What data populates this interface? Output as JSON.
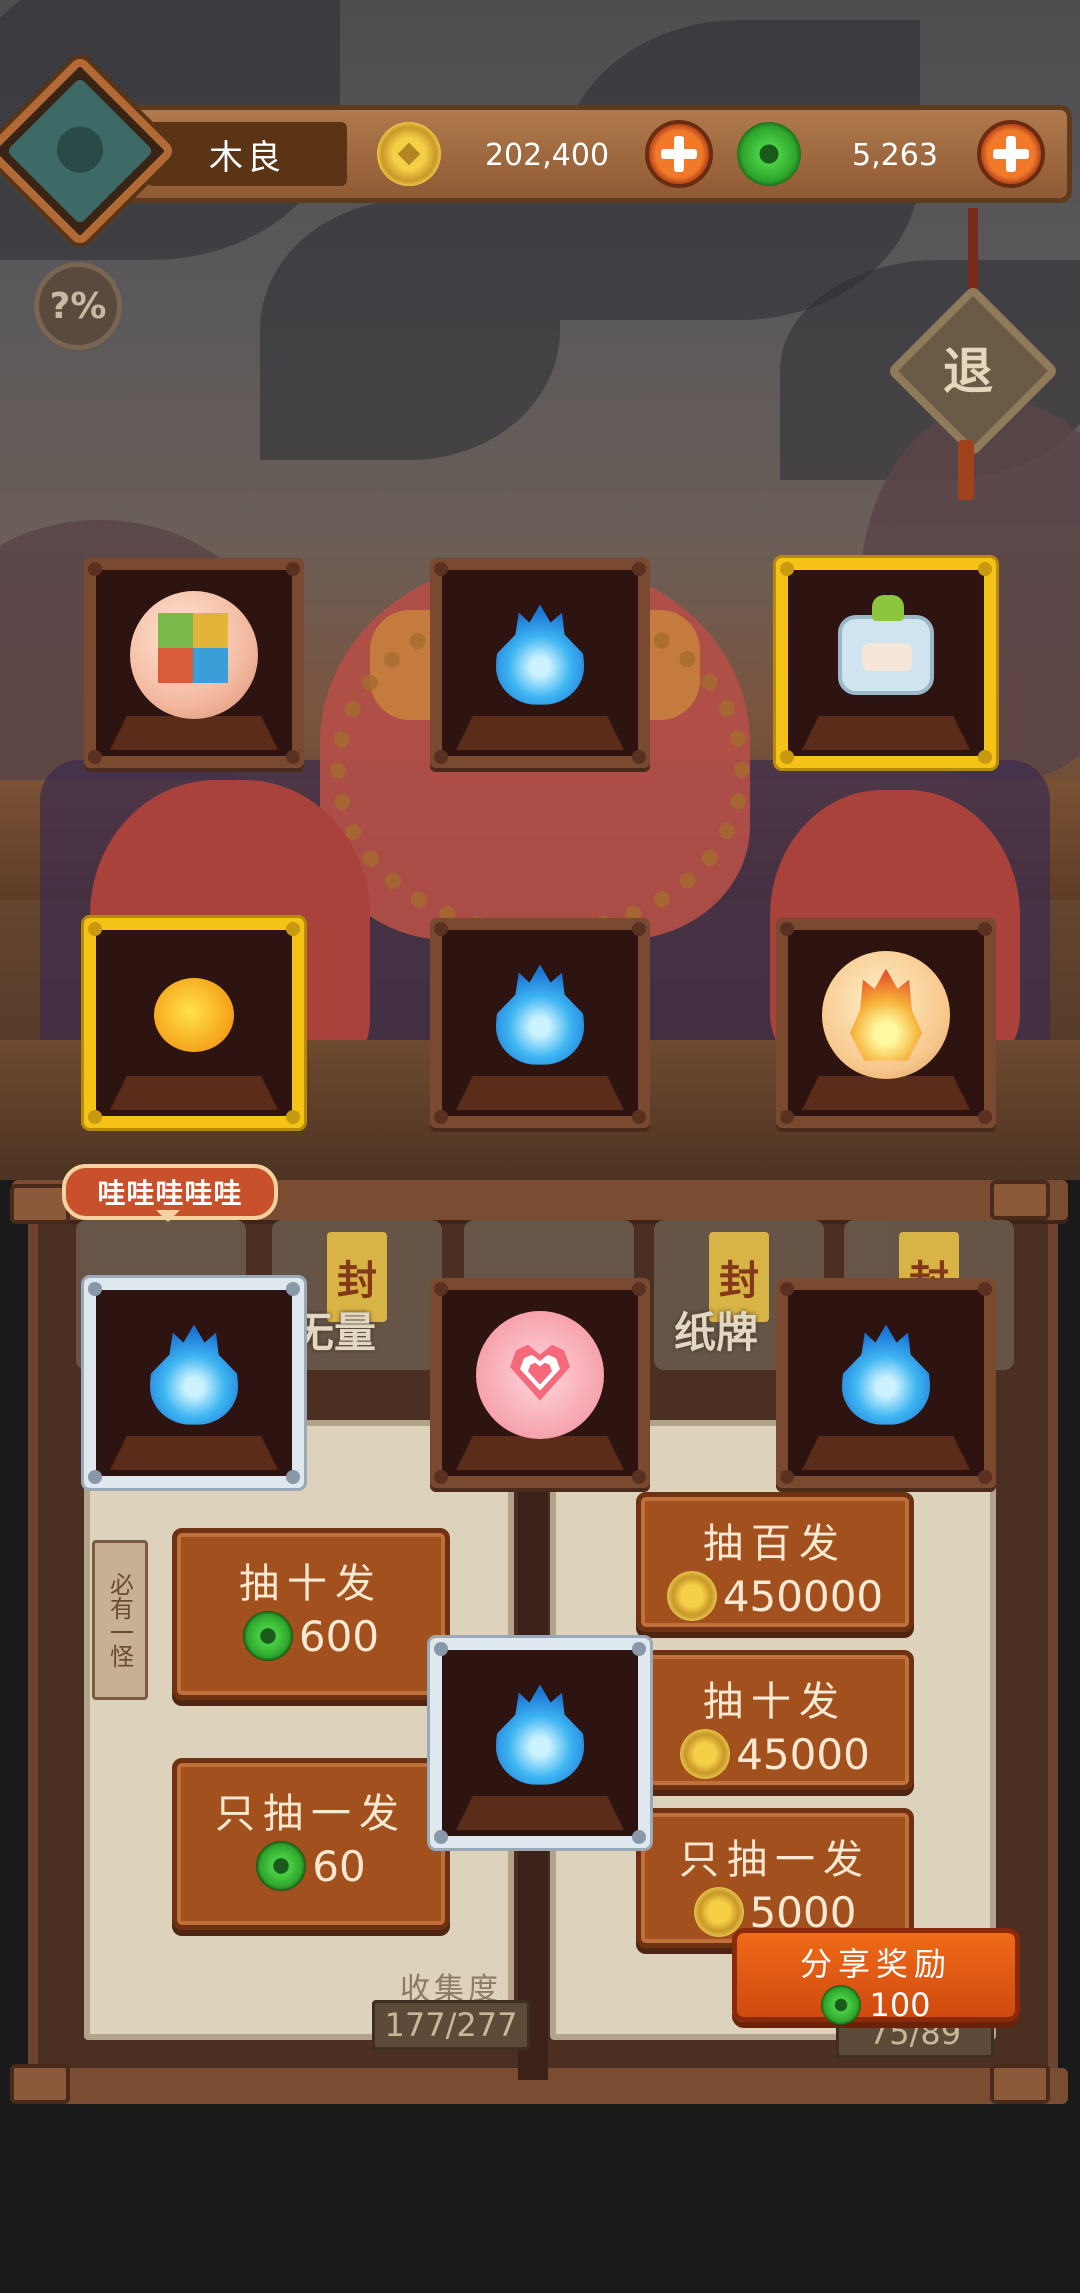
{
  "player": {
    "name": "木良"
  },
  "currency": {
    "gold": "202,400",
    "jade": "5,263"
  },
  "buttons": {
    "help": "?%",
    "exit": "退"
  },
  "reward_cards": [
    {
      "item": "rainbow-cube-orb",
      "frame": "bronze"
    },
    {
      "item": "blue-flame",
      "frame": "bronze"
    },
    {
      "item": "robot-toy",
      "frame": "gold"
    },
    {
      "item": "fire-chick",
      "frame": "gold"
    },
    {
      "item": "blue-flame",
      "frame": "bronze"
    },
    {
      "item": "fire-orb",
      "frame": "bronze"
    },
    {
      "item": "blue-flame",
      "frame": "silver"
    },
    {
      "item": "heart-orb",
      "frame": "bronze"
    },
    {
      "item": "blue-flame",
      "frame": "bronze"
    },
    {
      "item": "blue-flame",
      "frame": "silver"
    }
  ],
  "speech_badge": "哇哇哇哇哇",
  "tabs": [
    {
      "tag": "封",
      "label": ""
    },
    {
      "tag": "封",
      "label": "无量"
    },
    {
      "tag": "",
      "label": ""
    },
    {
      "tag": "封",
      "label": "纸牌"
    },
    {
      "tag": "封",
      "label": ""
    }
  ],
  "left_page": {
    "tag": "必有一怪",
    "pulls": [
      {
        "label": "抽十发",
        "currency": "jade",
        "price": "600"
      },
      {
        "label": "只抽一发",
        "currency": "jade",
        "price": "60"
      }
    ],
    "collection_label": "收集度",
    "collection": "177/277"
  },
  "right_page": {
    "pulls": [
      {
        "label": "抽百发",
        "currency": "gold",
        "price": "450000"
      },
      {
        "label": "抽十发",
        "currency": "gold",
        "price": "45000"
      },
      {
        "label": "只抽一发",
        "currency": "gold",
        "price": "5000"
      }
    ],
    "collection": "75/89"
  },
  "share": {
    "label": "分享奖励",
    "currency": "jade",
    "amount": "100"
  },
  "colors": {
    "gold_frame": "#f5c316",
    "bronze_frame": "#7a4a30",
    "silver_frame": "#dfe7ef",
    "share_button": "#e85a14"
  }
}
